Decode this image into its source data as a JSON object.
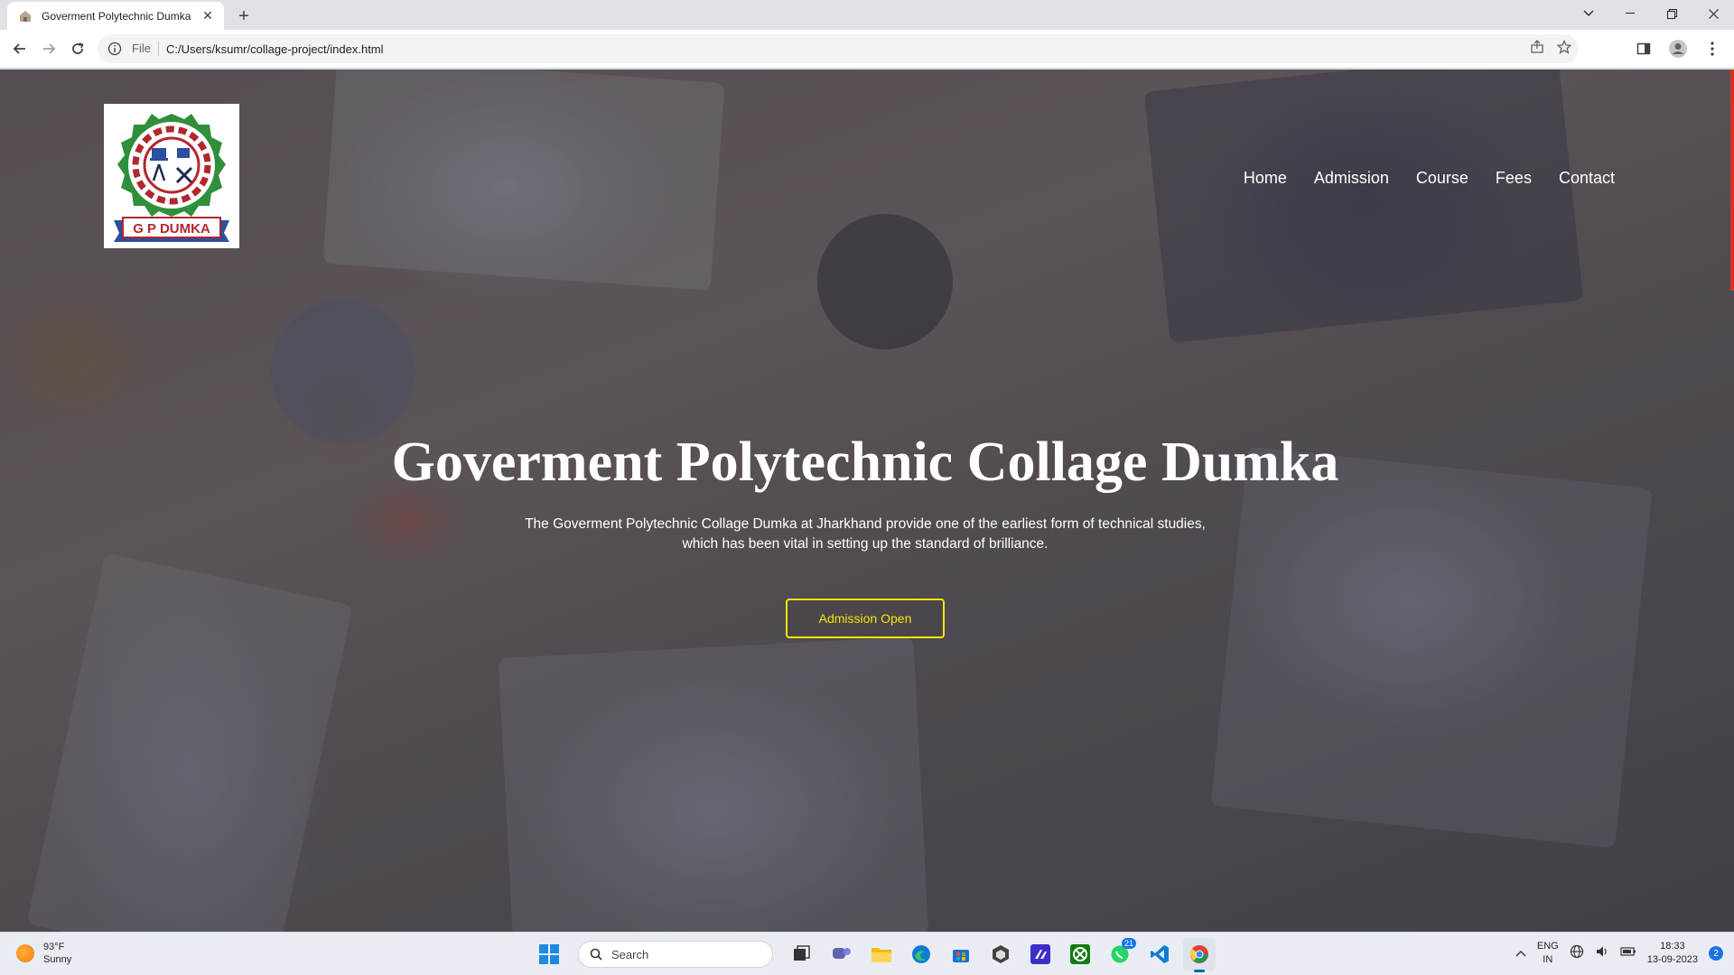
{
  "browser": {
    "tab_title": "Goverment Polytechnic Dumka",
    "file_label": "File",
    "url": "C:/Users/ksumr/collage-project/index.html"
  },
  "site": {
    "logo_text": "G P DUMKA",
    "nav": [
      "Home",
      "Admission",
      "Course",
      "Fees",
      "Contact"
    ],
    "hero_title": "Goverment Polytechnic Collage Dumka",
    "hero_sub_line1": "The Goverment Polytechnic Collage Dumka at Jharkhand provide one of the earliest form of technical studies,",
    "hero_sub_line2": "which has been vital in setting up the standard of brilliance.",
    "cta_label": "Admission Open",
    "cta_color": "#f3e600"
  },
  "taskbar": {
    "weather_temp": "93°F",
    "weather_desc": "Sunny",
    "search_placeholder": "Search",
    "whatsapp_badge": "21",
    "lang_top": "ENG",
    "lang_bottom": "IN",
    "time": "18:33",
    "date": "13-09-2023",
    "notification_count": "2"
  }
}
